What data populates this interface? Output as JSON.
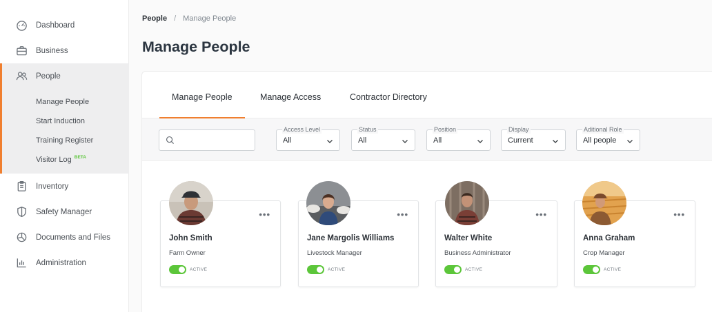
{
  "sidebar": {
    "items": [
      {
        "label": "Dashboard",
        "icon": "gauge-icon"
      },
      {
        "label": "Business",
        "icon": "briefcase-icon"
      },
      {
        "label": "People",
        "icon": "people-icon"
      },
      {
        "label": "Inventory",
        "icon": "clipboard-icon"
      },
      {
        "label": "Safety Manager",
        "icon": "shield-icon"
      },
      {
        "label": "Documents and Files",
        "icon": "documents-icon"
      },
      {
        "label": "Administration",
        "icon": "bar-chart-icon"
      }
    ],
    "people_subitems": [
      {
        "label": "Manage People"
      },
      {
        "label": "Start Induction"
      },
      {
        "label": "Training Register"
      },
      {
        "label": "Visitor Log",
        "badge": "BETA"
      }
    ],
    "accent_color": "#f07f2f"
  },
  "breadcrumb": {
    "root": "People",
    "separator": "/",
    "current": "Manage People"
  },
  "page_title": "Manage People",
  "tabs": [
    {
      "label": "Manage People",
      "active": true
    },
    {
      "label": "Manage Access",
      "active": false
    },
    {
      "label": "Contractor Directory",
      "active": false
    }
  ],
  "filters": {
    "search": {
      "placeholder": ""
    },
    "selects": [
      {
        "legend": "Access Level",
        "value": "All"
      },
      {
        "legend": "Status",
        "value": "All"
      },
      {
        "legend": "Position",
        "value": "All"
      },
      {
        "legend": "Display",
        "value": "Current"
      },
      {
        "legend": "Aditional Role",
        "value": "All people"
      }
    ]
  },
  "people": [
    {
      "name": "John Smith",
      "role": "Farm Owner",
      "status": "ACTIVE"
    },
    {
      "name": "Jane Margolis Williams",
      "role": "Livestock Manager",
      "status": "ACTIVE"
    },
    {
      "name": "Walter White",
      "role": "Business Administrator",
      "status": "ACTIVE"
    },
    {
      "name": "Anna Graham",
      "role": "Crop Manager",
      "status": "ACTIVE"
    }
  ],
  "menu_glyph": "•••",
  "status_color": "#5cc63a"
}
